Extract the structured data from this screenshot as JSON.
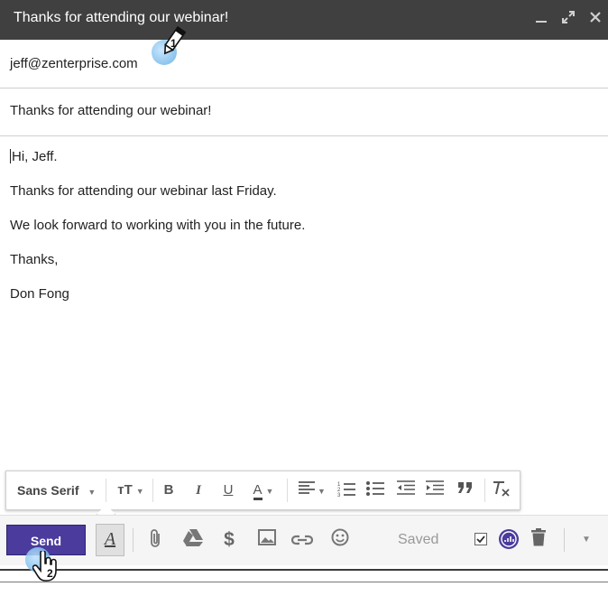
{
  "window": {
    "title": "Thanks for attending our webinar!",
    "minimize_icon": "minimize-icon",
    "expand_icon": "expand-icon",
    "close_icon": "close-icon"
  },
  "compose": {
    "to": "jeff@zenterprise.com",
    "subject": "Thanks for attending our webinar!",
    "body": [
      "Hi, Jeff.",
      "Thanks for attending our webinar last Friday.",
      "We look forward to working with you in the future.",
      "Thanks,",
      "Don Fong"
    ]
  },
  "formatting": {
    "font": "Sans Serif",
    "size_label": "тT",
    "bold": "B",
    "italic": "I",
    "underline": "U",
    "text_color": "A",
    "align": "align-icon",
    "numbered_list": "numbered-list-icon",
    "bulleted_list": "bulleted-list-icon",
    "indent_less": "indent-less-icon",
    "indent_more": "indent-more-icon",
    "quote": "quote-icon",
    "clear_formatting": "clear-formatting-icon"
  },
  "bottom": {
    "send_label": "Send",
    "formatting_toggle": "A",
    "saved_label": "Saved",
    "dollar": "$"
  },
  "callouts": {
    "step1": "1",
    "step2": "2"
  }
}
